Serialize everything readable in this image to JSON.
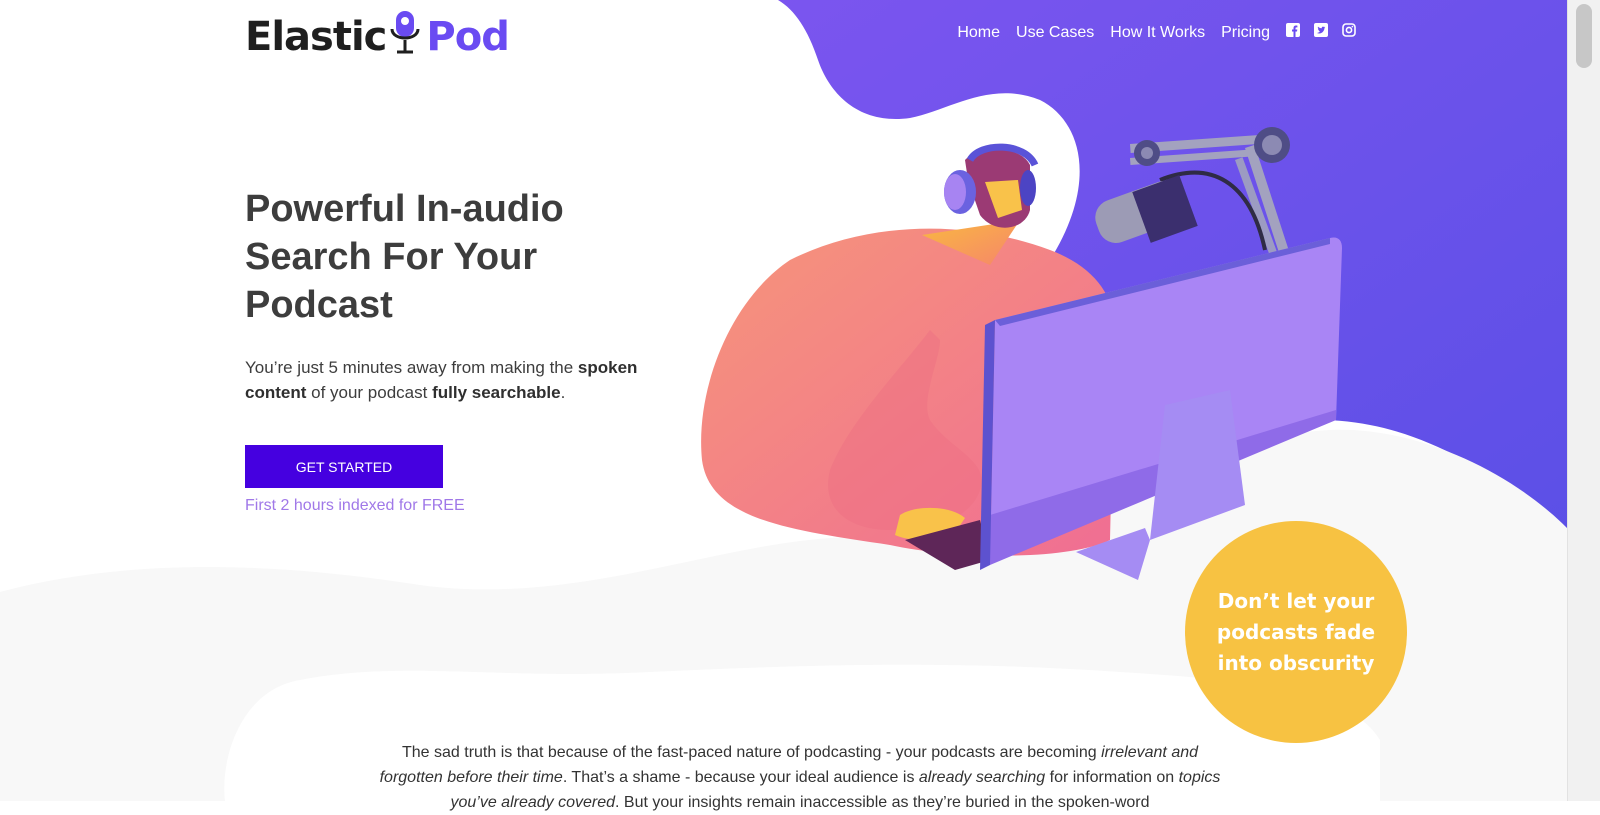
{
  "logo": {
    "part1": "Elastic",
    "part2": "Pod",
    "icon": "microphone-icon"
  },
  "nav": {
    "items": [
      "Home",
      "Use Cases",
      "How It Works",
      "Pricing"
    ],
    "social": [
      "facebook-icon",
      "twitter-icon",
      "instagram-icon"
    ]
  },
  "hero": {
    "title": "Powerful In-audio Search For Your Podcast",
    "subtitle_pre": "You’re just 5 minutes away from making the ",
    "subtitle_bold1": "spoken content",
    "subtitle_mid": " of your podcast ",
    "subtitle_bold2": "fully searchable",
    "subtitle_post": ".",
    "cta_label": "GET STARTED",
    "free_note": "First 2 hours indexed for FREE"
  },
  "badge": {
    "text": "Don’t let your podcasts fade into obscurity"
  },
  "intro": {
    "t1": "The sad truth is that because of the fast-paced nature of podcasting - your podcasts are becoming ",
    "i1": "irrelevant and forgotten before their time",
    "t2": ". That’s a shame - because your ideal audience is ",
    "i2": "already searching",
    "t3": " for information on ",
    "i3": "topics you’ve already covered",
    "t4": ". But your insights remain inaccessible as they’re buried in the spoken-word"
  },
  "colors": {
    "brand_purple": "#6a4bf2",
    "cta": "#4500e0",
    "badge": "#f7c242",
    "free_note": "#a078e8"
  }
}
